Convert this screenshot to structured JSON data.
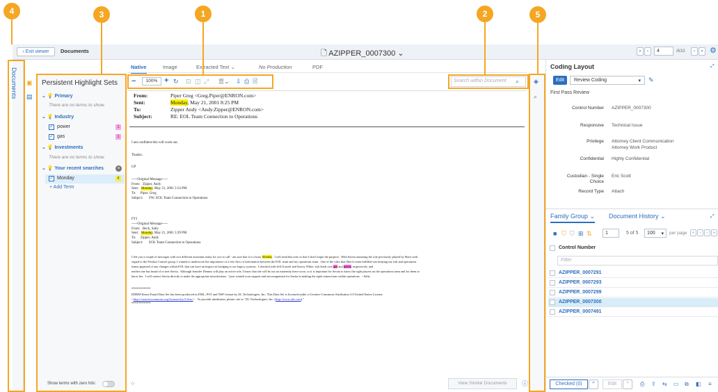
{
  "callouts": [
    "1",
    "2",
    "3",
    "4",
    "5"
  ],
  "header": {
    "exit_label": "Exit viewer",
    "documents_label": "Documents",
    "doc_title": "AZIPPER_0007300",
    "page_value": "4",
    "page_total": "/633"
  },
  "left_rail": {
    "label": "Documents"
  },
  "highlight_panel": {
    "title": "Persistent Highlight Sets",
    "primary": {
      "label": "Primary",
      "empty": "There are no terms to show."
    },
    "industry": {
      "label": "Industry",
      "terms": [
        {
          "label": "power",
          "count": "1"
        },
        {
          "label": "gas",
          "count": "1"
        }
      ]
    },
    "investments": {
      "label": "Investments",
      "empty": "There are no terms to show."
    },
    "recent": {
      "label": "Your recent searches",
      "terms": [
        {
          "label": "Monday",
          "count": "4"
        }
      ],
      "add_term": "Add Term"
    },
    "show_zero": "Show terms with zero hits:"
  },
  "viewer": {
    "tabs": [
      "Native",
      "Image",
      "Extracted Text",
      "No Production",
      "PDF"
    ],
    "zoom": "100%",
    "search_placeholder": "Search within Document",
    "view_similar": "View Similar Documents"
  },
  "email": {
    "from_label": "From:",
    "from_value": "Piper Greg <Greg.Piper@ENRON.com>",
    "sent_label": "Sent:",
    "sent_hl": "Monday",
    "sent_rest": ", May 21, 2001 8:25 PM",
    "to_label": "To:",
    "to_value": "Zipper Andy <Andy.Zipper@ENRON.com>",
    "subject_label": "Subject:",
    "subject_value": "RE: EOL Team Connection to Operations",
    "body1": "I am confident this will work out.",
    "body2": "Thanks.",
    "body3": "GP",
    "orig1": "-----Original Message-----\nFrom:   Zipper, Andy",
    "orig1_sent_pre": "Sent:   ",
    "orig1_sent_hl": "Monday",
    "orig1_sent_post": ", May 21, 2001 5:54 PM",
    "orig1_rest": "To:     Piper, Greg\nSubject:       FW: EOL Team Connection to Operations",
    "fyi": "FYI",
    "orig2": "-----Original Message-----\nFrom:   Beck, Sally",
    "orig2_sent_pre": "Sent:   ",
    "orig2_sent_hl": "Monday",
    "orig2_sent_post": ", May 21, 2001 5:39 PM",
    "orig2_rest": "To:     Zipper, Andy\nSubject:       EOL Team Connection to Operations",
    "para_l1a": "I left you a couple of messages with two different assistants today for you to call - am sure that it is a busy ",
    "para_l1_hl": "Monday",
    "para_l1b": ".  I will send this note so that I don't forget the purpose.  With Savita assuming the role previously played by Sheri with",
    "para_l2": "regard to the Product Control group, I wanted to underscore the importance of a free flow of information between the EOL team and my operations team.  One of the roles that Sheri's team fulfilled was keeping my risk and operations",
    "para_l3a": "teams apprised of any changes within EOL that can have an impact on bridging to our legacy systems.  I checked with Jeff Gossett and Stacey White, risk leads over ",
    "para_l3_gas": "gas",
    "para_l3b": " and ",
    "para_l3_power": "power",
    "para_l3c": ", respectively, and",
    "para_l4": "neither one has heard of or met Savita.  Although Jennifer Denney will play an active role, I know that she will be out on maternity leave soon, so it is important for Savita to know the right players on the operations team and for them to",
    "para_l5": "know her.  I will contact Savita directly to make the appropriate introductions.  I just wanted your support and encouragement for Savita in making the right connections within operations.  --Sally",
    "stars": "***********",
    "footer1": "EDRM Enron Email Data Set has been produced in EML, PST and NSF format by ZL Technologies, Inc. This Data Set is licensed under a Creative Commons Attribution 3.0 United States License",
    "footer2a": "<",
    "footer2_link1": "http://creativecommons.org/licenses/by/3.0/us/",
    "footer2b": ">   To provide attribution, please cite to \"ZL Technologies, Inc. (",
    "footer2_link2": "http://www.zlti.com",
    "footer2c": ").\"",
    "stars2": "***********"
  },
  "coding": {
    "title": "Coding Layout",
    "edit": "Edit",
    "layout_select": "Review Coding",
    "section": "First Pass Review",
    "fields": [
      {
        "label": "Control Number",
        "value": "AZIPPER_0007300"
      },
      {
        "label": "Responsive",
        "value": "Technical Issue"
      },
      {
        "label": "Privilege",
        "value": "Attorney Client Communication"
      },
      {
        "label": "",
        "value": "Attorney Work Product"
      },
      {
        "label": "Confidential",
        "value": "Highly Confidential"
      },
      {
        "label": "Custodian - Single",
        "value": "Eric Scott"
      },
      {
        "label": "Choice",
        "value": ""
      },
      {
        "label": "Record Type",
        "value": "Attach"
      }
    ]
  },
  "family": {
    "tab1": "Family Group",
    "tab2": "Document History",
    "page_value": "1",
    "of_text": "5 of 5",
    "per_page_value": "100",
    "per_page_label": "per page",
    "column": "Control Number",
    "filter": "Filter",
    "rows": [
      "AZIPPER_0007291",
      "AZIPPER_0007293",
      "AZIPPER_0007299",
      "AZIPPER_0007300",
      "AZIPPER_0007491"
    ],
    "checked": "Checked (0)",
    "edit": "Edit"
  },
  "colors": {
    "accent": "#2c6ebd",
    "callout": "#f5a623",
    "highlight_yellow": "#f9f200",
    "highlight_pink": "#f063d5",
    "selected_row": "#d7edf7"
  }
}
